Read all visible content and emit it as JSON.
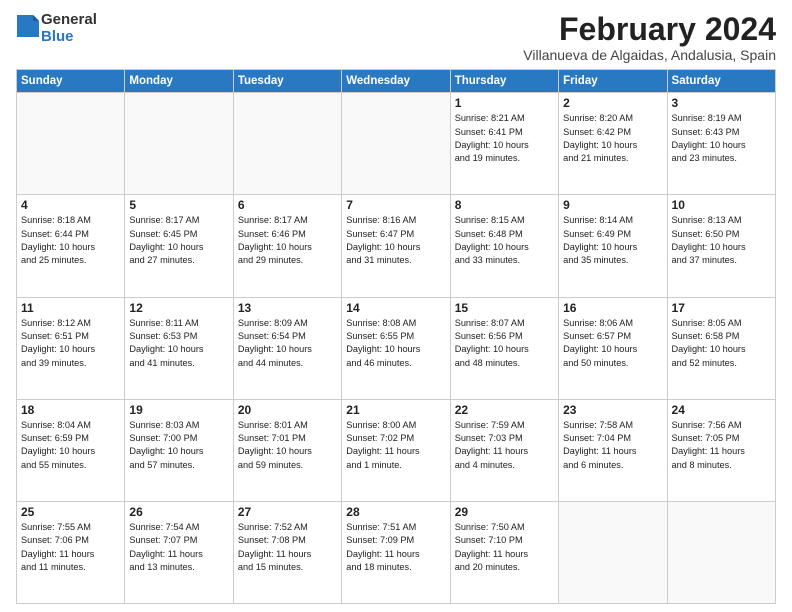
{
  "header": {
    "logo_general": "General",
    "logo_blue": "Blue",
    "title": "February 2024",
    "subtitle": "Villanueva de Algaidas, Andalusia, Spain"
  },
  "weekdays": [
    "Sunday",
    "Monday",
    "Tuesday",
    "Wednesday",
    "Thursday",
    "Friday",
    "Saturday"
  ],
  "weeks": [
    [
      {
        "day": "",
        "info": ""
      },
      {
        "day": "",
        "info": ""
      },
      {
        "day": "",
        "info": ""
      },
      {
        "day": "",
        "info": ""
      },
      {
        "day": "1",
        "info": "Sunrise: 8:21 AM\nSunset: 6:41 PM\nDaylight: 10 hours\nand 19 minutes."
      },
      {
        "day": "2",
        "info": "Sunrise: 8:20 AM\nSunset: 6:42 PM\nDaylight: 10 hours\nand 21 minutes."
      },
      {
        "day": "3",
        "info": "Sunrise: 8:19 AM\nSunset: 6:43 PM\nDaylight: 10 hours\nand 23 minutes."
      }
    ],
    [
      {
        "day": "4",
        "info": "Sunrise: 8:18 AM\nSunset: 6:44 PM\nDaylight: 10 hours\nand 25 minutes."
      },
      {
        "day": "5",
        "info": "Sunrise: 8:17 AM\nSunset: 6:45 PM\nDaylight: 10 hours\nand 27 minutes."
      },
      {
        "day": "6",
        "info": "Sunrise: 8:17 AM\nSunset: 6:46 PM\nDaylight: 10 hours\nand 29 minutes."
      },
      {
        "day": "7",
        "info": "Sunrise: 8:16 AM\nSunset: 6:47 PM\nDaylight: 10 hours\nand 31 minutes."
      },
      {
        "day": "8",
        "info": "Sunrise: 8:15 AM\nSunset: 6:48 PM\nDaylight: 10 hours\nand 33 minutes."
      },
      {
        "day": "9",
        "info": "Sunrise: 8:14 AM\nSunset: 6:49 PM\nDaylight: 10 hours\nand 35 minutes."
      },
      {
        "day": "10",
        "info": "Sunrise: 8:13 AM\nSunset: 6:50 PM\nDaylight: 10 hours\nand 37 minutes."
      }
    ],
    [
      {
        "day": "11",
        "info": "Sunrise: 8:12 AM\nSunset: 6:51 PM\nDaylight: 10 hours\nand 39 minutes."
      },
      {
        "day": "12",
        "info": "Sunrise: 8:11 AM\nSunset: 6:53 PM\nDaylight: 10 hours\nand 41 minutes."
      },
      {
        "day": "13",
        "info": "Sunrise: 8:09 AM\nSunset: 6:54 PM\nDaylight: 10 hours\nand 44 minutes."
      },
      {
        "day": "14",
        "info": "Sunrise: 8:08 AM\nSunset: 6:55 PM\nDaylight: 10 hours\nand 46 minutes."
      },
      {
        "day": "15",
        "info": "Sunrise: 8:07 AM\nSunset: 6:56 PM\nDaylight: 10 hours\nand 48 minutes."
      },
      {
        "day": "16",
        "info": "Sunrise: 8:06 AM\nSunset: 6:57 PM\nDaylight: 10 hours\nand 50 minutes."
      },
      {
        "day": "17",
        "info": "Sunrise: 8:05 AM\nSunset: 6:58 PM\nDaylight: 10 hours\nand 52 minutes."
      }
    ],
    [
      {
        "day": "18",
        "info": "Sunrise: 8:04 AM\nSunset: 6:59 PM\nDaylight: 10 hours\nand 55 minutes."
      },
      {
        "day": "19",
        "info": "Sunrise: 8:03 AM\nSunset: 7:00 PM\nDaylight: 10 hours\nand 57 minutes."
      },
      {
        "day": "20",
        "info": "Sunrise: 8:01 AM\nSunset: 7:01 PM\nDaylight: 10 hours\nand 59 minutes."
      },
      {
        "day": "21",
        "info": "Sunrise: 8:00 AM\nSunset: 7:02 PM\nDaylight: 11 hours\nand 1 minute."
      },
      {
        "day": "22",
        "info": "Sunrise: 7:59 AM\nSunset: 7:03 PM\nDaylight: 11 hours\nand 4 minutes."
      },
      {
        "day": "23",
        "info": "Sunrise: 7:58 AM\nSunset: 7:04 PM\nDaylight: 11 hours\nand 6 minutes."
      },
      {
        "day": "24",
        "info": "Sunrise: 7:56 AM\nSunset: 7:05 PM\nDaylight: 11 hours\nand 8 minutes."
      }
    ],
    [
      {
        "day": "25",
        "info": "Sunrise: 7:55 AM\nSunset: 7:06 PM\nDaylight: 11 hours\nand 11 minutes."
      },
      {
        "day": "26",
        "info": "Sunrise: 7:54 AM\nSunset: 7:07 PM\nDaylight: 11 hours\nand 13 minutes."
      },
      {
        "day": "27",
        "info": "Sunrise: 7:52 AM\nSunset: 7:08 PM\nDaylight: 11 hours\nand 15 minutes."
      },
      {
        "day": "28",
        "info": "Sunrise: 7:51 AM\nSunset: 7:09 PM\nDaylight: 11 hours\nand 18 minutes."
      },
      {
        "day": "29",
        "info": "Sunrise: 7:50 AM\nSunset: 7:10 PM\nDaylight: 11 hours\nand 20 minutes."
      },
      {
        "day": "",
        "info": ""
      },
      {
        "day": "",
        "info": ""
      }
    ]
  ]
}
